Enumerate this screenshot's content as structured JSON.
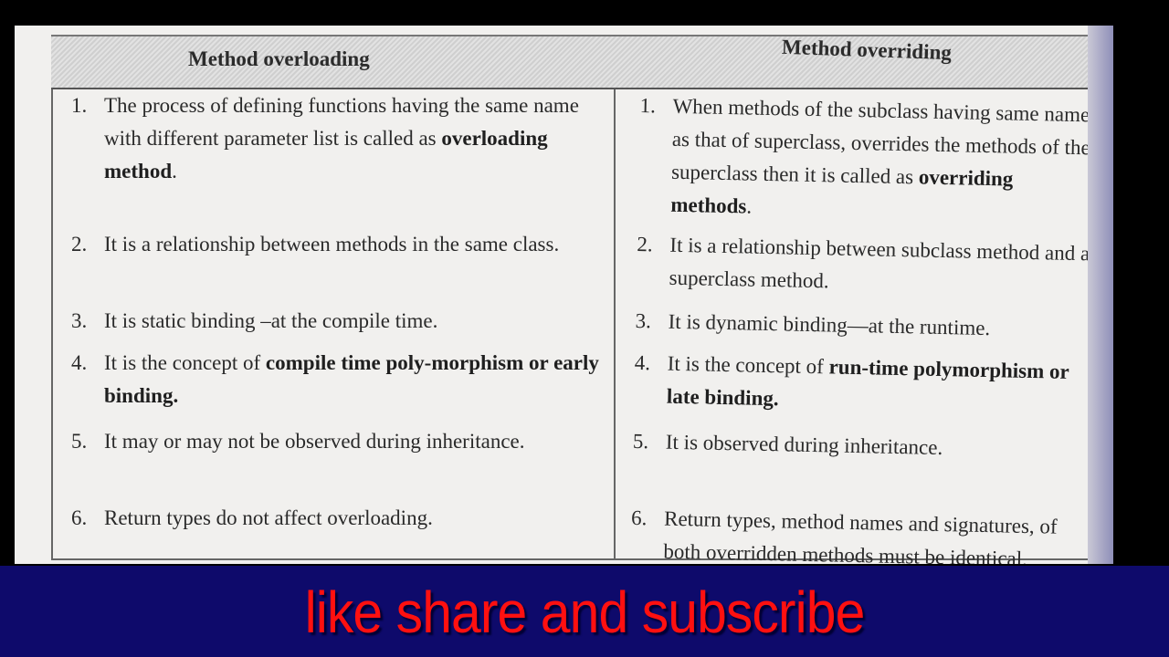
{
  "table": {
    "headers": [
      "Method overloading",
      "Method overriding"
    ],
    "overloading": [
      {
        "num": "1.",
        "parts": [
          [
            "The process of defining functions having the same name with different parameter list is called as ",
            false
          ],
          [
            "overloading method",
            true
          ],
          [
            ".",
            false
          ]
        ]
      },
      {
        "num": "2.",
        "parts": [
          [
            "It is a relationship between methods in the same class.",
            false
          ]
        ]
      },
      {
        "num": "3.",
        "parts": [
          [
            "It is static binding –at the compile time.",
            false
          ]
        ]
      },
      {
        "num": "4.",
        "parts": [
          [
            "It is the concept of ",
            false
          ],
          [
            "compile time poly-morphism or early binding.",
            true
          ]
        ]
      },
      {
        "num": "5.",
        "parts": [
          [
            "It may or may not be observed during inheritance.",
            false
          ]
        ]
      },
      {
        "num": "6.",
        "parts": [
          [
            "Return types do not affect overloading.",
            false
          ]
        ]
      }
    ],
    "overriding": [
      {
        "num": "1.",
        "parts": [
          [
            "When methods of the subclass having same name as that of superclass, overrides the methods of the superclass then it is called as ",
            false
          ],
          [
            "overriding methods",
            true
          ],
          [
            ".",
            false
          ]
        ]
      },
      {
        "num": "2.",
        "parts": [
          [
            "It is a relationship between subclass method and a superclass method.",
            false
          ]
        ]
      },
      {
        "num": "3.",
        "parts": [
          [
            "It is dynamic binding—at the runtime.",
            false
          ]
        ]
      },
      {
        "num": "4.",
        "parts": [
          [
            "It is the concept of ",
            false
          ],
          [
            "run-time polymorphism or late binding.",
            true
          ]
        ]
      },
      {
        "num": "5.",
        "parts": [
          [
            "It is observed during inheritance.",
            false
          ]
        ]
      },
      {
        "num": "6.",
        "parts": [
          [
            "Return types, method names and signatures, of both overridden methods must be identical.",
            false
          ]
        ]
      }
    ]
  },
  "banner": {
    "text": "like share and subscribe",
    "color": "#ff1010",
    "background": "#0e0a6b"
  }
}
